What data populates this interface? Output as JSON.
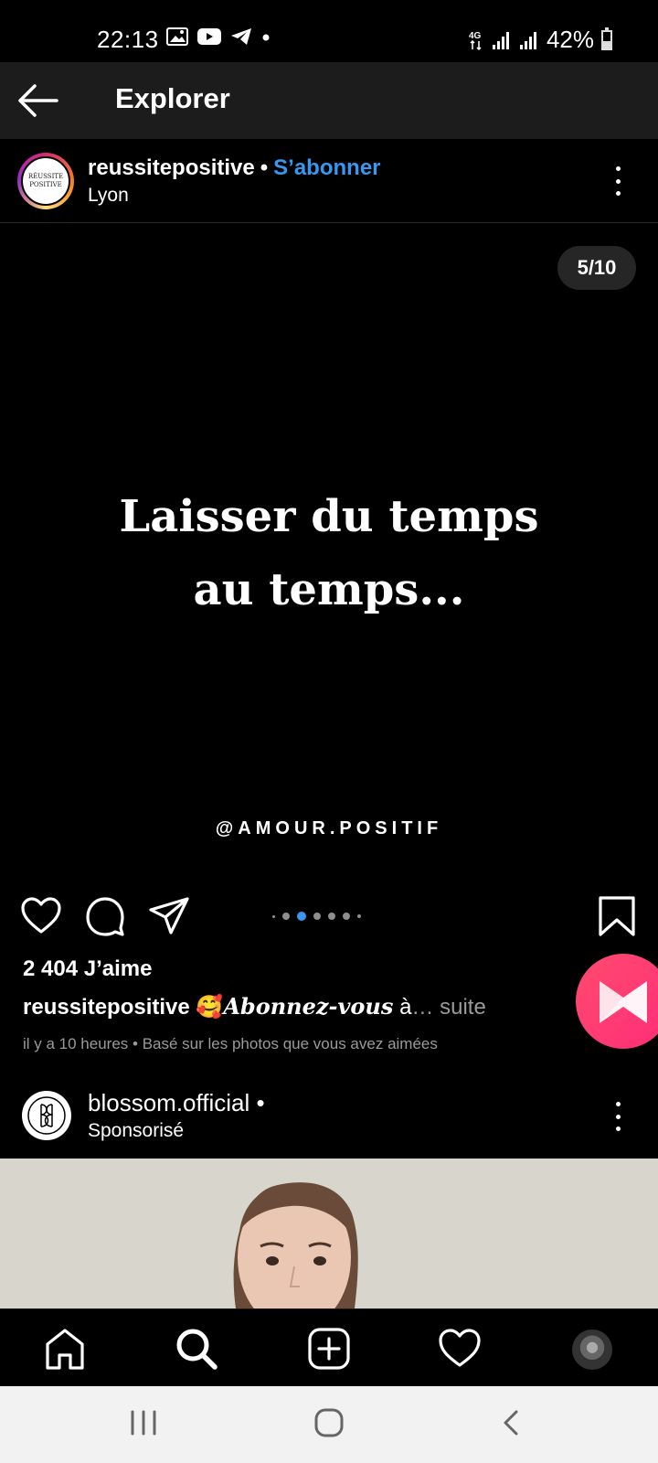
{
  "status_bar": {
    "time": "22:13",
    "battery_text": "42%",
    "battery_level": 0.42,
    "network": "4G",
    "icons": [
      "gallery-icon",
      "youtube-icon",
      "telegram-icon",
      "notification-dot-icon",
      "network-4g-icon",
      "signal-icon",
      "signal-icon",
      "battery-icon"
    ]
  },
  "header": {
    "title": "Explorer",
    "back_icon": "arrow-left-icon"
  },
  "post": {
    "username": "reussitepositive",
    "separator": "•",
    "follow_label": "S’abonner",
    "location": "Lyon",
    "avatar_text_line1": "RÉUSSITE",
    "avatar_text_line2": "POSITIVE",
    "slide_counter": "5/10",
    "quote_line1": "Laisser du temps",
    "quote_line2": "au temps...",
    "watermark": "@AMOUR.POSITIF",
    "carousel": {
      "total_dots": 7,
      "active_index": 2
    },
    "likes": "2 404 J’aime",
    "caption_user": "reussitepositive",
    "caption_emoji": "🥰",
    "caption_text": "Abonnez-vous",
    "caption_tail": " à",
    "caption_more": "… suite",
    "meta": "il y a 10 heures • Basé sur les photos que vous avez aimées"
  },
  "post2": {
    "username": "blossom.official",
    "separator": "•",
    "subtitle": "Sponsorisé"
  },
  "bottom_nav": [
    "home-icon",
    "search-icon",
    "add-post-icon",
    "activity-heart-icon",
    "profile-avatar"
  ],
  "system_nav": [
    "recent-apps-icon",
    "home-button-icon",
    "back-chevron-icon"
  ],
  "colors": {
    "accent": "#3897f0",
    "header_bg": "#1c1c1c",
    "bubble": "#ff2d78",
    "system_nav_bg": "#f2f2f2"
  }
}
